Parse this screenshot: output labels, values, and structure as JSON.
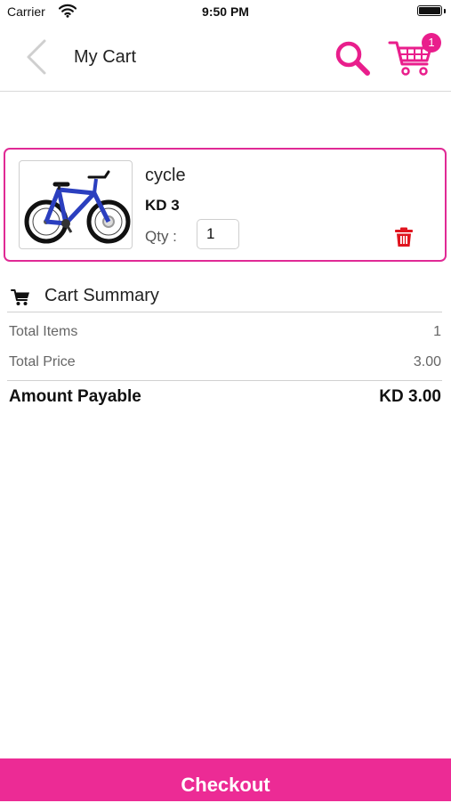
{
  "status_bar": {
    "carrier": "Carrier",
    "time": "9:50 PM",
    "wifi_icon": "wifi-icon",
    "battery_icon": "battery-icon"
  },
  "nav": {
    "title": "My Cart",
    "back_icon": "chevron-left-icon",
    "search_icon": "search-icon",
    "cart_icon": "shopping-cart-icon",
    "cart_badge": "1",
    "accent_color": "#e91e8c"
  },
  "cart": {
    "items": [
      {
        "name": "cycle",
        "price": "KD 3",
        "qty_label": "Qty :",
        "qty_value": "1",
        "image_icon": "bicycle-image",
        "delete_icon": "trash-icon"
      }
    ]
  },
  "summary": {
    "title": "Cart Summary",
    "title_icon": "cart-icon",
    "total_items_label": "Total Items",
    "total_items_value": "1",
    "total_price_label": "Total Price",
    "total_price_value": "3.00",
    "amount_payable_label": "Amount Payable",
    "amount_payable_value": "KD 3.00"
  },
  "checkout": {
    "label": "Checkout",
    "color": "#ec2b95"
  }
}
